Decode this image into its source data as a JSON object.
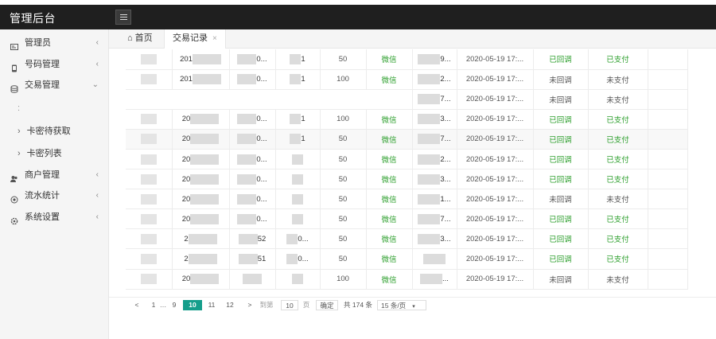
{
  "header": {
    "title": "管理后台"
  },
  "sidebar": {
    "items": [
      {
        "label": "管理员",
        "arrow": "‹"
      },
      {
        "label": "号码管理",
        "arrow": "‹"
      },
      {
        "label": "交易管理",
        "arrow": "⌄"
      }
    ],
    "sub_placeholder": ":",
    "subitems": [
      {
        "label": "卡密待获取"
      },
      {
        "label": "卡密列表"
      }
    ],
    "items2": [
      {
        "label": "商户管理",
        "arrow": "‹"
      },
      {
        "label": "流水统计",
        "arrow": "‹"
      },
      {
        "label": "系统设置",
        "arrow": "‹"
      }
    ]
  },
  "tabs": [
    {
      "label": "首页"
    },
    {
      "label": "交易记录"
    }
  ],
  "table": {
    "rows": [
      {
        "c2": "201",
        "c3": "0...",
        "c4": "1",
        "amount": "50",
        "method": "微信",
        "c7": "1",
        "c8": "9...",
        "time": "2020-05-19 17:...",
        "callback": "已回调",
        "pay": "已支付"
      },
      {
        "c2": "201",
        "c3": "0...",
        "c4": "1",
        "amount": "100",
        "method": "微信",
        "c7": "",
        "c8": "2...",
        "time": "2020-05-19 17:...",
        "callback": "未回调",
        "pay": "未支付"
      },
      {
        "c2": "",
        "c3": "",
        "c4": "",
        "amount": "",
        "method": "",
        "c7": "",
        "c8": "7...",
        "time": "2020-05-19 17:...",
        "callback": "未回调",
        "pay": "未支付"
      },
      {
        "c2": "20",
        "c3": "0...",
        "c4": "1",
        "amount": "100",
        "method": "微信",
        "c7": "",
        "c8": "3...",
        "time": "2020-05-19 17:...",
        "callback": "已回调",
        "pay": "已支付"
      },
      {
        "c2": "20",
        "c3": "0...",
        "c4": "1",
        "amount": "50",
        "method": "微信",
        "c7": "",
        "c8": "7...",
        "time": "2020-05-19 17:...",
        "callback": "已回调",
        "pay": "已支付"
      },
      {
        "c2": "20",
        "c3": "0...",
        "c4": "",
        "amount": "50",
        "method": "微信",
        "c7": "",
        "c8": "2...",
        "time": "2020-05-19 17:...",
        "callback": "已回调",
        "pay": "已支付"
      },
      {
        "c2": "20",
        "c3": "0...",
        "c4": "",
        "amount": "50",
        "method": "微信",
        "c7": "",
        "c8": "3...",
        "time": "2020-05-19 17:...",
        "callback": "已回调",
        "pay": "已支付"
      },
      {
        "c2": "20",
        "c3": "0...",
        "c4": "",
        "amount": "50",
        "method": "微信",
        "c7": "",
        "c8": "1...",
        "time": "2020-05-19 17:...",
        "callback": "未回调",
        "pay": "未支付"
      },
      {
        "c2": "20",
        "c3": "0...",
        "c4": "",
        "amount": "50",
        "method": "微信",
        "c7": "",
        "c8": "7...",
        "time": "2020-05-19 17:...",
        "callback": "已回调",
        "pay": "已支付"
      },
      {
        "c2": "2",
        "c3": "52",
        "c4": "0...",
        "amount": "50",
        "method": "微信",
        "c7": "",
        "c8": "3...",
        "time": "2020-05-19 17:...",
        "callback": "已回调",
        "pay": "已支付"
      },
      {
        "c2": "2",
        "c3": "51",
        "c4": "0...",
        "amount": "50",
        "method": "微信",
        "c7": "",
        "c8": "",
        "time": "2020-05-19 17:...",
        "callback": "已回调",
        "pay": "已支付"
      },
      {
        "c2": "20",
        "c3": "",
        "c4": "",
        "amount": "100",
        "method": "微信",
        "c7": "",
        "c8": "...",
        "time": "2020-05-19 17:...",
        "callback": "未回调",
        "pay": "未支付"
      }
    ]
  },
  "pager": {
    "prev": "<",
    "first": "1",
    "ellipsis": "…",
    "p9": "9",
    "current": "10",
    "p11": "11",
    "p12": "12",
    "next": ">",
    "goto_label": "到第",
    "goto_value": "10",
    "page_unit": "页",
    "confirm": "确定",
    "total": "共 174 条",
    "per_page": "15 条/页",
    "per_page_caret": "▾"
  },
  "colors": {
    "topbar": "#1f1f1f",
    "accent": "#159e8b",
    "status_green": "#2d9f2d"
  }
}
